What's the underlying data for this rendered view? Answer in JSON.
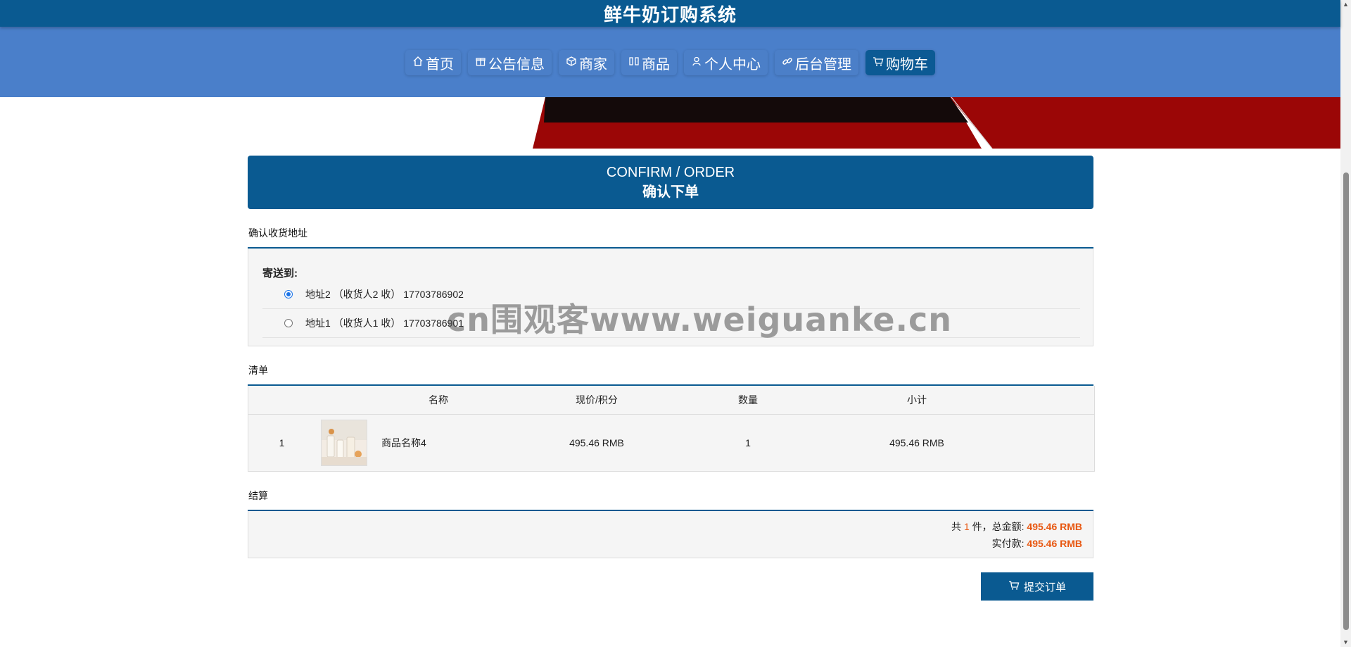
{
  "app": {
    "title": "鲜牛奶订购系统"
  },
  "nav": {
    "items": [
      {
        "label": "首页",
        "icon": "home-icon"
      },
      {
        "label": "公告信息",
        "icon": "gift-icon"
      },
      {
        "label": "商家",
        "icon": "box-icon"
      },
      {
        "label": "商品",
        "icon": "columns-icon"
      },
      {
        "label": "个人中心",
        "icon": "user-icon"
      },
      {
        "label": "后台管理",
        "icon": "link-icon"
      },
      {
        "label": "购物车",
        "icon": "cart-icon",
        "active": true
      }
    ]
  },
  "order": {
    "header_en": "CONFIRM / ORDER",
    "header_cn": "确认下单"
  },
  "address": {
    "section_title": "确认收货地址",
    "ship_label": "寄送到:",
    "items": [
      {
        "text": "地址2 （收货人2 收） 17703786902",
        "selected": true
      },
      {
        "text": "地址1 （收货人1 收） 17703786901",
        "selected": false
      }
    ]
  },
  "list": {
    "section_title": "清单",
    "columns": [
      "名称",
      "现价/积分",
      "数量",
      "小计"
    ],
    "rows": [
      {
        "index": "1",
        "name": "商品名称4",
        "price": "495.46 RMB",
        "qty": "1",
        "subtotal": "495.46 RMB"
      }
    ]
  },
  "settlement": {
    "section_title": "结算",
    "count_prefix": "共",
    "count": "1",
    "count_suffix": "件，总金额:",
    "total": "495.46 RMB",
    "paid_label": "实付款:",
    "paid": "495.46 RMB"
  },
  "actions": {
    "submit_label": "提交订单"
  },
  "watermark": "cn围观客www.weiguanke.cn",
  "colors": {
    "primary": "#0a5a91",
    "nav_band": "#4a7fca",
    "accent": "#e8560f"
  }
}
